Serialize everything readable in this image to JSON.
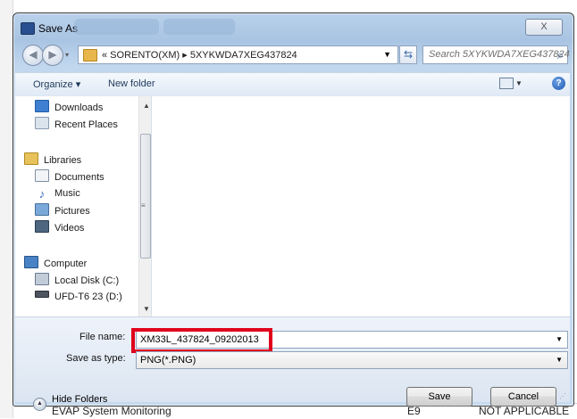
{
  "background": {
    "bottom_row": {
      "left": "EVAP System Monitoring",
      "mid": "E9",
      "right": "NOT APPLICABLE"
    }
  },
  "dialog": {
    "title": "Save As",
    "close_label": "X"
  },
  "address_bar": {
    "path": "«  SORENTO(XM)  ▸  5XYKWDA7XEG437824",
    "search_placeholder": "Search 5XYKWDA7XEG437824"
  },
  "toolbar": {
    "organize_label": "Organize ▾",
    "new_folder_label": "New folder"
  },
  "nav_pane": {
    "items": [
      {
        "label": "Downloads",
        "icon": "downloads-icon"
      },
      {
        "label": "Recent Places",
        "icon": "recent-places-icon"
      },
      {
        "label": "Libraries",
        "icon": "libraries-icon"
      },
      {
        "label": "Documents",
        "icon": "documents-icon"
      },
      {
        "label": "Music",
        "icon": "music-icon"
      },
      {
        "label": "Pictures",
        "icon": "pictures-icon"
      },
      {
        "label": "Videos",
        "icon": "videos-icon"
      },
      {
        "label": "Computer",
        "icon": "computer-icon"
      },
      {
        "label": "Local Disk (C:)",
        "icon": "local-disk-icon"
      },
      {
        "label": "UFD-T6 23 (D:)",
        "icon": "usb-drive-icon"
      }
    ]
  },
  "form": {
    "file_name_label": "File name:",
    "file_name_value": "XM33L_437824_09202013",
    "save_type_label": "Save as type:",
    "save_type_value": "PNG(*.PNG)"
  },
  "footer": {
    "hide_folders_label": "Hide Folders",
    "save_label": "Save",
    "cancel_label": "Cancel"
  },
  "colors": {
    "highlight_border": "#e0001b",
    "frame": "#b9d1ea"
  }
}
